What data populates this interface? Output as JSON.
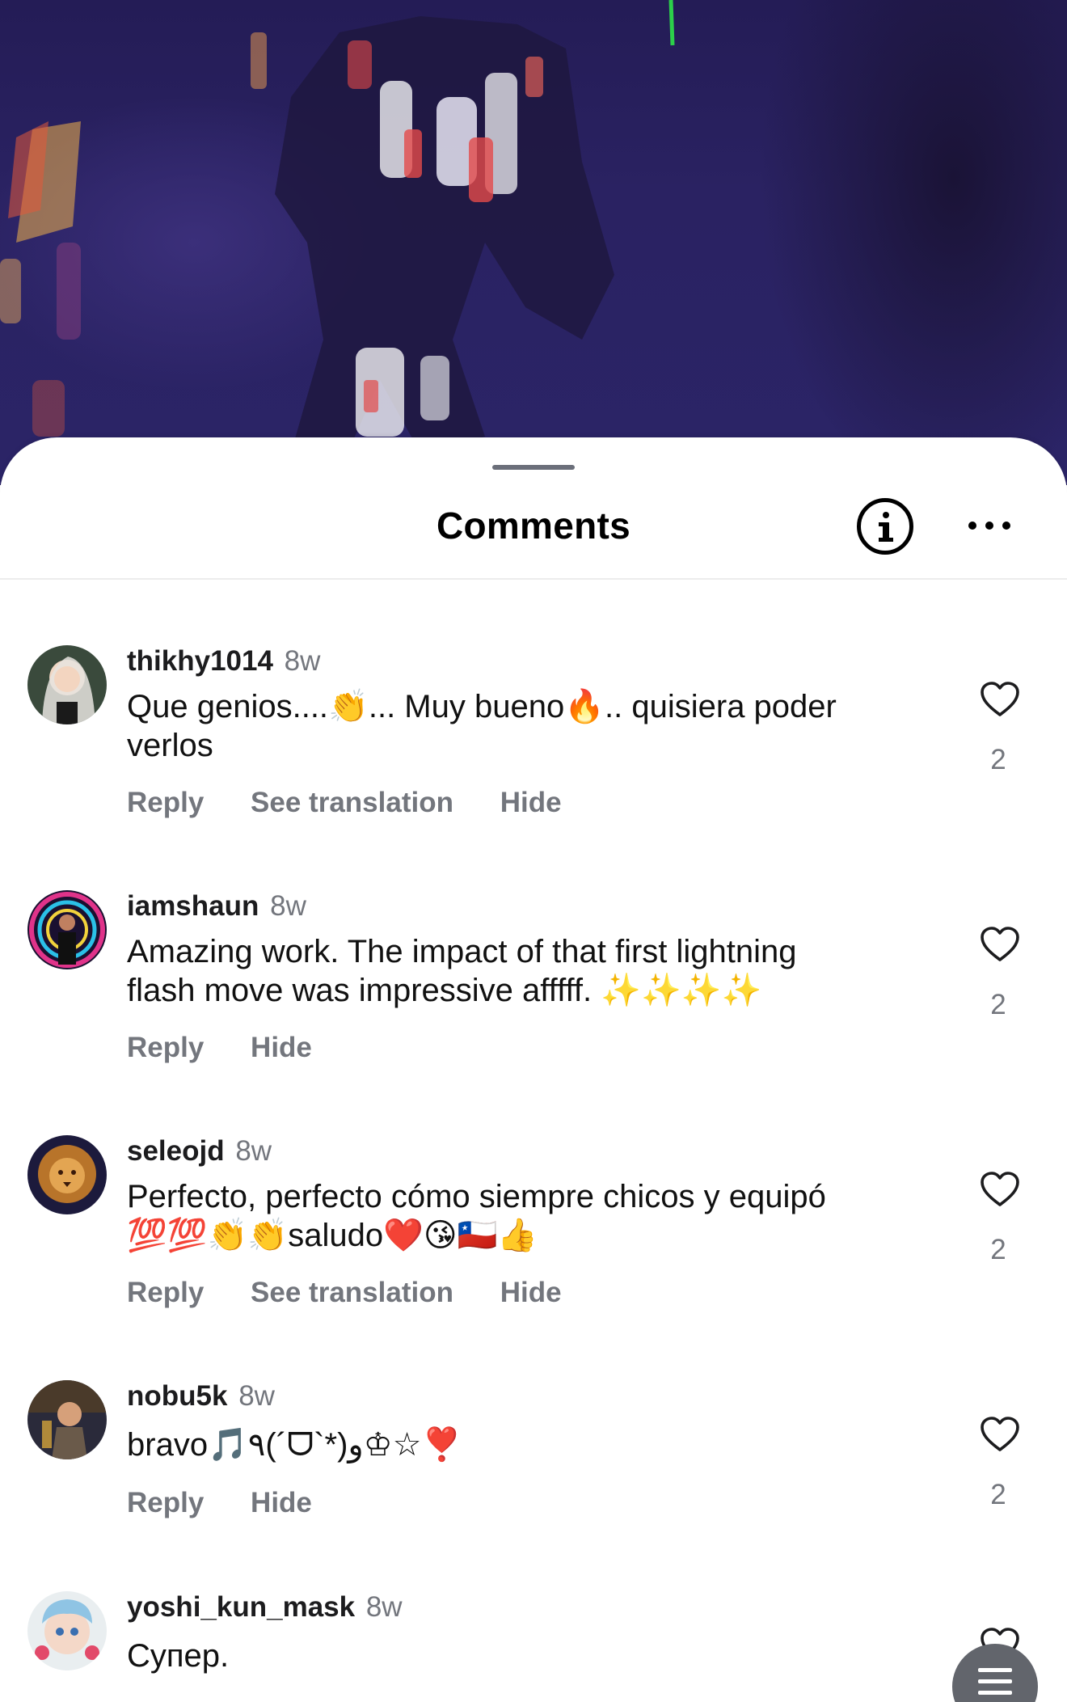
{
  "sheet": {
    "title": "Comments"
  },
  "icons": {
    "info": "info-circle-icon",
    "more": "more-horizontal-icon",
    "like": "heart-outline-icon",
    "fab": "text-lines-icon"
  },
  "colors": {
    "text_primary": "#111111",
    "text_secondary": "#73767d",
    "background": "#ffffff"
  },
  "comments": [
    {
      "username": "thikhy1014",
      "age": "8w",
      "text_line1": "Que genios....👏... Muy bueno🔥.. quisiera poder",
      "text_line2": "verlos",
      "actions": [
        "Reply",
        "See translation",
        "Hide"
      ],
      "likes": "2"
    },
    {
      "username": "iamshaun",
      "age": "8w",
      "text_line1": "Amazing work. The impact of that first lightning",
      "text_line2": "flash move was impressive afffff. ✨✨✨✨",
      "actions": [
        "Reply",
        "Hide"
      ],
      "likes": "2"
    },
    {
      "username": "seleojd",
      "age": "8w",
      "text_line1": "Perfecto, perfecto cómo siempre chicos y equipó",
      "text_line2": "💯💯👏👏saludo❤️😘🇨🇱👍",
      "actions": [
        "Reply",
        "See translation",
        "Hide"
      ],
      "likes": "2"
    },
    {
      "username": "nobu5k",
      "age": "8w",
      "text_line1": "bravo🎵٩(´ᗜ`*)و♔☆❣️",
      "text_line2": "",
      "actions": [
        "Reply",
        "Hide"
      ],
      "likes": "2"
    },
    {
      "username": "yoshi_kun_mask",
      "age": "8w",
      "text_line1": "Супер.",
      "text_line2": "",
      "actions": [],
      "likes": ""
    }
  ]
}
